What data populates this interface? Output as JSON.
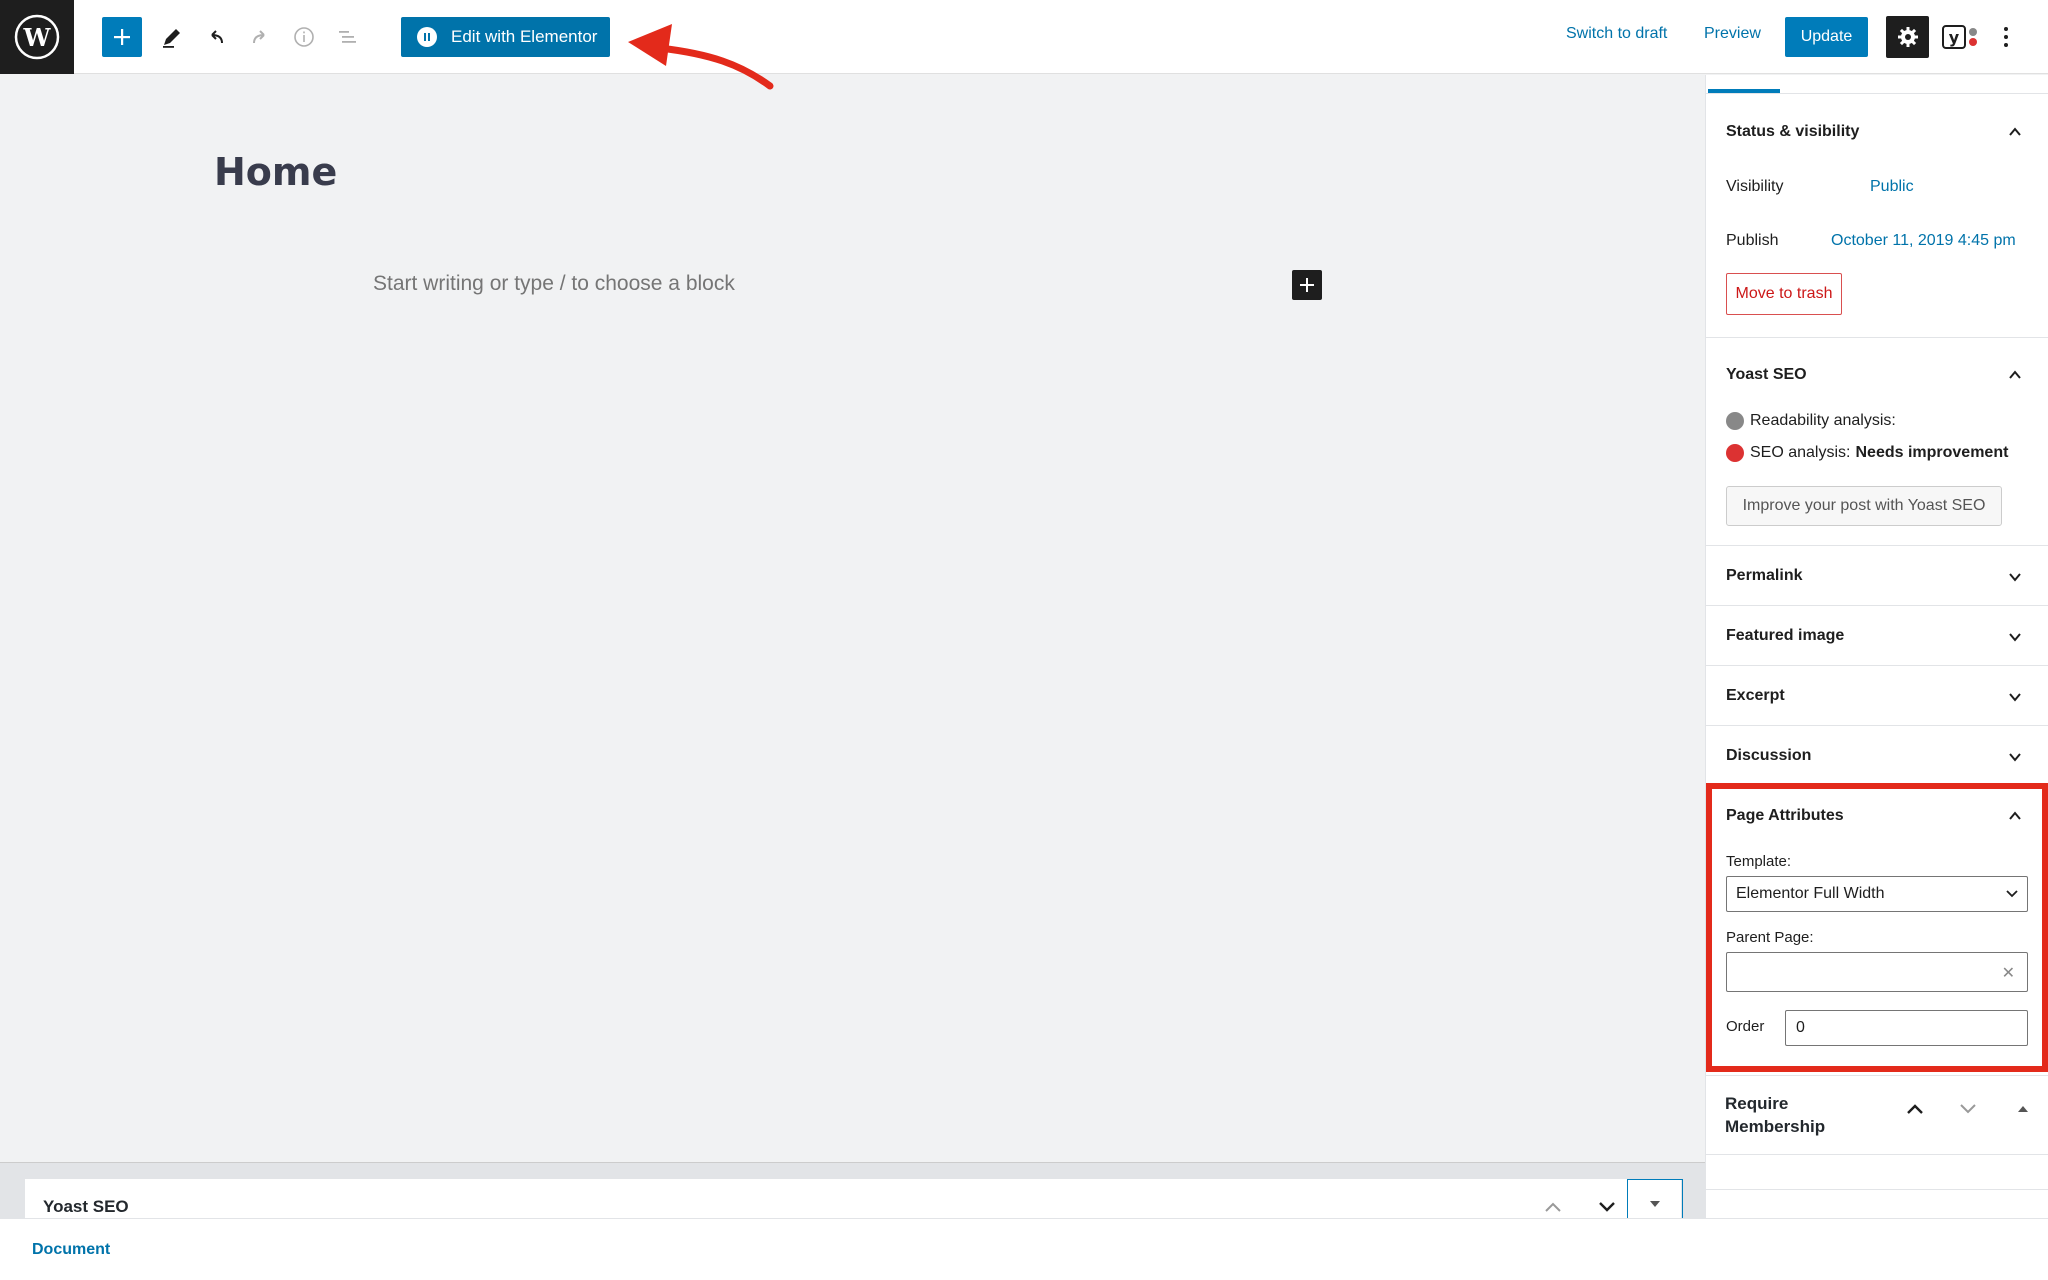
{
  "toolbar": {
    "elementor_label": "Edit with Elementor",
    "switch_to_draft": "Switch to draft",
    "preview": "Preview",
    "update": "Update",
    "accent_color": "#007cba"
  },
  "editor": {
    "title": "Home",
    "block_placeholder": "Start writing or type / to choose a block"
  },
  "sidebar": {
    "status_visibility": {
      "title": "Status & visibility",
      "visibility_label": "Visibility",
      "visibility_value": "Public",
      "publish_label": "Publish",
      "publish_value": "October 11, 2019 4:45 pm",
      "trash_label": "Move to trash"
    },
    "yoast": {
      "title": "Yoast SEO",
      "readability": "Readability analysis:",
      "seo_prefix": "SEO analysis:",
      "seo_status": "Needs improvement",
      "improve_button": "Improve your post with Yoast SEO"
    },
    "collapsed_panels": [
      "Permalink",
      "Featured image",
      "Excerpt",
      "Discussion"
    ],
    "page_attributes": {
      "title": "Page Attributes",
      "template_label": "Template:",
      "template_value": "Elementor Full Width",
      "parent_label": "Parent Page:",
      "parent_value": "",
      "order_label": "Order",
      "order_value": "0"
    },
    "require_membership": {
      "title": "Require Membership"
    }
  },
  "bottom": {
    "yoast_box_title": "Yoast SEO",
    "breadcrumb": "Document"
  },
  "icons": [
    "wordpress-logo-icon",
    "plus-icon",
    "pencil-icon",
    "undo-icon",
    "redo-icon",
    "info-icon",
    "outline-icon",
    "elementor-icon",
    "gear-icon",
    "yoast-icon",
    "more-vertical-icon",
    "chevron-up-icon",
    "chevron-down-icon",
    "close-icon",
    "annotation-arrow-icon"
  ],
  "annotation_color": "#e32a1b"
}
